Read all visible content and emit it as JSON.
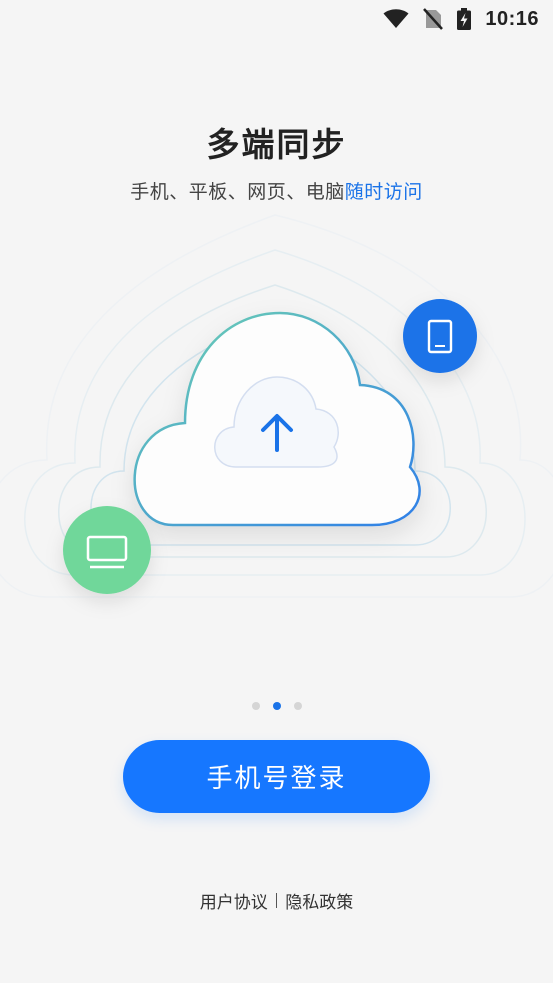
{
  "status_bar": {
    "time": "10:16",
    "icons": [
      "wifi-icon",
      "no-sim-icon",
      "battery-charging-icon"
    ]
  },
  "header": {
    "title": "多端同步",
    "subtitle_main": "手机、平板、网页、电脑",
    "subtitle_highlight": "随时访问"
  },
  "illustration": {
    "cloud_icon": "cloud-upload-icon",
    "phone_icon": "phone-icon",
    "monitor_icon": "monitor-icon",
    "colors": {
      "phone_badge": "#1a73e8",
      "monitor_badge": "#6fd79a",
      "upload_arrow": "#1a73e8"
    }
  },
  "pager": {
    "total": 3,
    "active_index": 1
  },
  "login": {
    "label": "手机号登录"
  },
  "footer": {
    "user_agreement": "用户协议",
    "privacy_policy": "隐私政策"
  },
  "colors": {
    "accent": "#1677ff",
    "background": "#f5f5f5"
  }
}
